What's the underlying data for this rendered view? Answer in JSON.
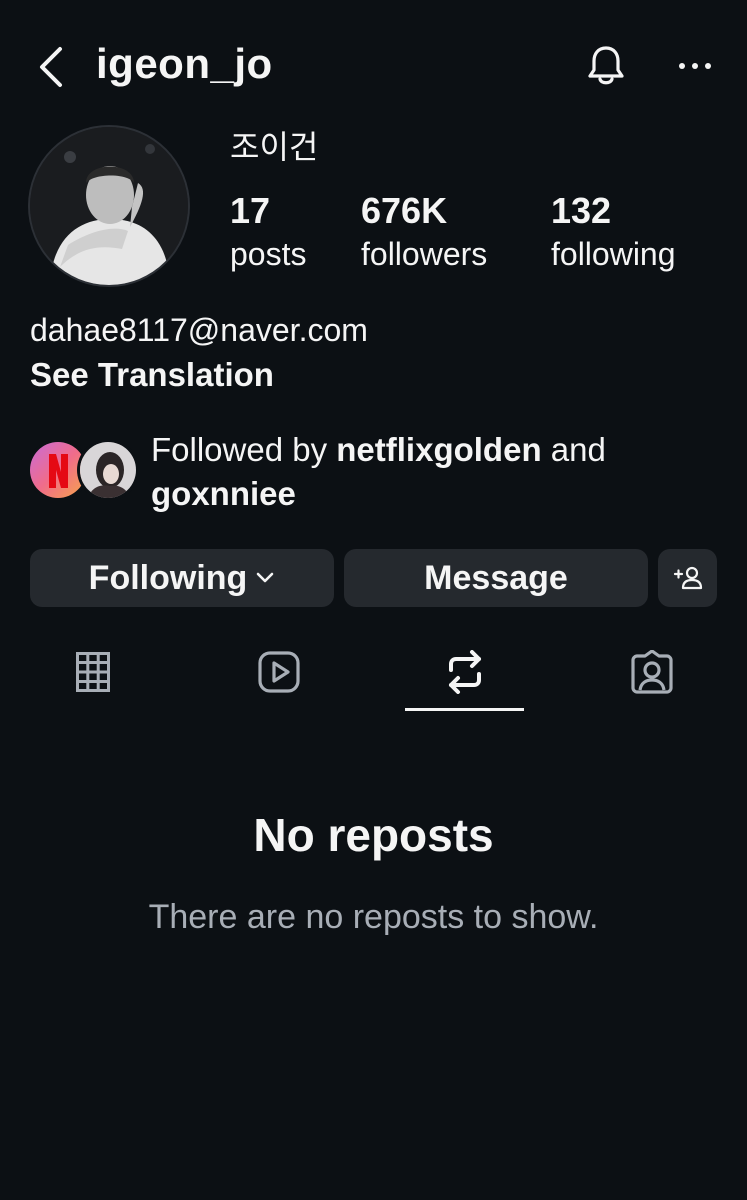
{
  "header": {
    "back_icon": "chevron-left-icon",
    "username": "igeon_jo",
    "bell_icon": "bell-icon",
    "more_icon": "more-horizontal-icon"
  },
  "profile": {
    "full_name": "조이건",
    "stats": [
      {
        "value": "17",
        "label": "posts"
      },
      {
        "value": "676K",
        "label": "followers"
      },
      {
        "value": "132",
        "label": "following"
      }
    ],
    "bio": "dahae8117@naver.com",
    "see_translation": "See Translation"
  },
  "followed_by": {
    "prefix": "Followed by",
    "user1": "netflixgolden",
    "connector": "and",
    "user2": "goxnniee"
  },
  "actions": {
    "following_label": "Following",
    "message_label": "Message",
    "add_user_icon": "add-person-icon"
  },
  "tabs": [
    "grid-icon",
    "reels-icon",
    "reposts-icon",
    "tagged-icon"
  ],
  "active_tab": "reposts",
  "empty_state": {
    "title": "No reposts",
    "subtitle": "There are no reposts to show."
  },
  "colors": {
    "background": "#0c1014",
    "button": "#25292e",
    "text": "#f5f5f5",
    "muted": "#a8aeb6",
    "netflix_red": "#e50914"
  }
}
